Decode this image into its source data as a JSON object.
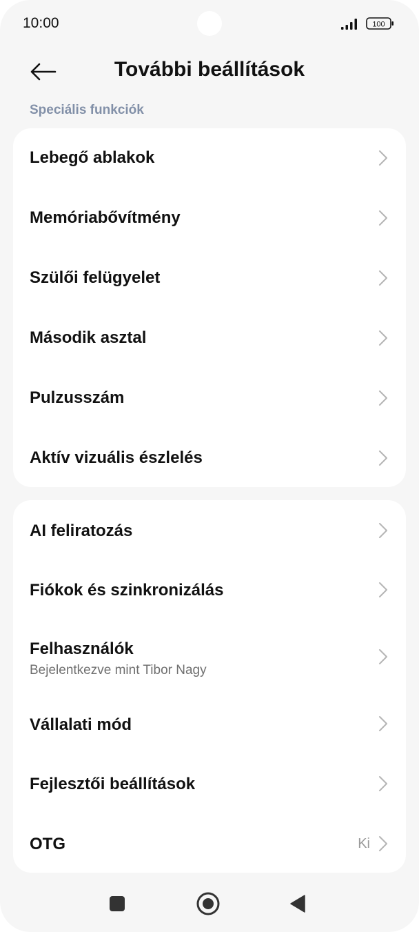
{
  "status_bar": {
    "time": "10:00",
    "battery": "100",
    "signal_icon": "signal-bars-icon",
    "battery_icon": "battery-icon"
  },
  "header": {
    "title": "További beállítások",
    "back_icon": "arrow-left-icon"
  },
  "section": {
    "label": "Speciális funkciók"
  },
  "group1": [
    {
      "label": "Lebegő ablakok"
    },
    {
      "label": "Memóriabővítmény"
    },
    {
      "label": "Szülői felügyelet"
    },
    {
      "label": "Második asztal"
    },
    {
      "label": "Pulzusszám"
    },
    {
      "label": "Aktív vizuális észlelés"
    }
  ],
  "group2": [
    {
      "label": "AI feliratozás"
    },
    {
      "label": "Fiókok és szinkronizálás"
    },
    {
      "label": "Felhasználók",
      "sub": "Bejelentkezve mint Tibor Nagy"
    },
    {
      "label": "Vállalati mód"
    },
    {
      "label": "Fejlesztői beállítások"
    },
    {
      "label": "OTG",
      "value": "Ki"
    }
  ],
  "nav": {
    "recents_icon": "square-icon",
    "home_icon": "circle-home-icon",
    "back_icon": "triangle-back-icon"
  },
  "colors": {
    "background": "#f6f6f6",
    "card": "#ffffff",
    "section_label": "#8290a8",
    "text": "#111111",
    "subtext": "#6f6f6f",
    "chevron": "#b5b5b5"
  }
}
